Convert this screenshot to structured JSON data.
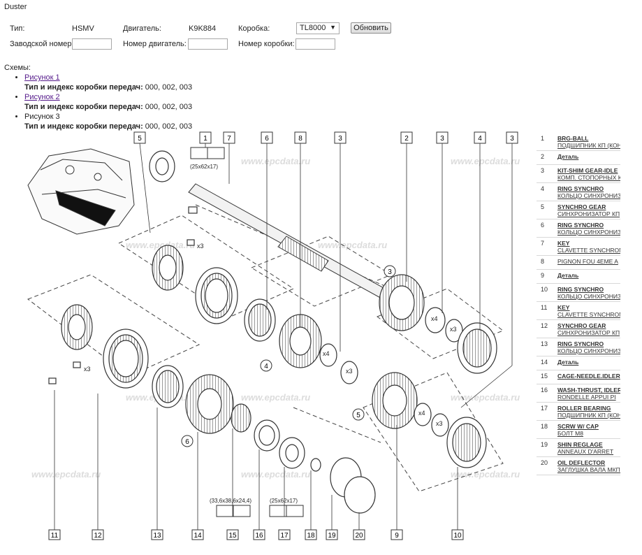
{
  "title": "Duster",
  "filters": {
    "type_label": "Тип:",
    "type_value": "HSMV",
    "engine_label": "Двигатель:",
    "engine_value": "K9K884",
    "gearbox_label": "Коробка:",
    "gearbox_selected": "TL8000",
    "refresh_label": "Обновить",
    "factory_no_label": "Заводской номер:",
    "engine_no_label": "Номер двигатель:",
    "gearbox_no_label": "Номер коробки:"
  },
  "schemes": {
    "title": "Схемы:",
    "items": [
      {
        "label": "Рисунок 1",
        "sub_label": "Тип и индекс коробки передач:",
        "sub_value": " 000, 002, 003",
        "link": true
      },
      {
        "label": "Рисунок 2",
        "sub_label": "Тип и индекс коробки передач:",
        "sub_value": " 000, 002, 003",
        "link": true
      },
      {
        "label": "Рисунок 3",
        "sub_label": "Тип и индекс коробки передач:",
        "sub_value": " 000, 002, 003",
        "link": false
      }
    ]
  },
  "diagram": {
    "watermark": "www.epcdata.ru",
    "top_callouts": [
      "5",
      "1",
      "7",
      "6",
      "8",
      "3",
      "2",
      "3",
      "4",
      "3"
    ],
    "bottom_callouts": [
      "11",
      "12",
      "13",
      "14",
      "15",
      "16",
      "17",
      "18",
      "19",
      "20"
    ],
    "circle_callouts": [
      "3",
      "4",
      "5",
      "6"
    ],
    "dim_1": "(25x62x17)",
    "dim_15": "(33,6x38,6x24,4)",
    "dim_17": "(25x62x17)",
    "qty_x3": "x3",
    "qty_x4": "x4"
  },
  "parts": [
    {
      "num": "1",
      "name": "BRG-BALL",
      "desc": "ПОДШИПНИК КП (КОНИ"
    },
    {
      "num": "2",
      "name": "Деталь",
      "desc": ""
    },
    {
      "num": "3",
      "name": "KIT-SHIM GEAR-IDLE",
      "desc": "КОМП. СТОПОРНЫХ КО"
    },
    {
      "num": "4",
      "name": "RING SYNCHRO",
      "desc": "КОЛЬЦО СИНХРОНИЗАТ"
    },
    {
      "num": "5",
      "name": "SYNCHRO GEAR",
      "desc": "СИНХРОНИЗАТОР КП"
    },
    {
      "num": "6",
      "name": "RING SYNCHRO",
      "desc": "КОЛЬЦО СИНХРОНИЗАТ"
    },
    {
      "num": "7",
      "name": "KEY",
      "desc": "CLAVETTE SYNCHRON"
    },
    {
      "num": "8",
      "name": "",
      "desc": "PIGNON FOU 4EME A"
    },
    {
      "num": "9",
      "name": "Деталь",
      "desc": ""
    },
    {
      "num": "10",
      "name": "RING SYNCHRO",
      "desc": "КОЛЬЦО СИНХРОНИЗАТ"
    },
    {
      "num": "11",
      "name": "KEY",
      "desc": "CLAVETTE SYNCHRON"
    },
    {
      "num": "12",
      "name": "SYNCHRO GEAR",
      "desc": "СИНХРОНИЗАТОР КП"
    },
    {
      "num": "13",
      "name": "RING SYNCHRO",
      "desc": "КОЛЬЦО СИНХРОНИЗАТ"
    },
    {
      "num": "14",
      "name": "Деталь",
      "desc": ""
    },
    {
      "num": "15",
      "name": "CAGE-NEEDLE.IDLER",
      "desc": ""
    },
    {
      "num": "16",
      "name": "WASH-THRUST, IDLER",
      "desc": "RONDELLE APPUI PI"
    },
    {
      "num": "17",
      "name": "ROLLER BEARING",
      "desc": "ПОДШИПНИК КП (КОНИ"
    },
    {
      "num": "18",
      "name": "SCRW W/ CAP",
      "desc": "БОЛТ M8"
    },
    {
      "num": "19",
      "name": "SHIN REGLAGE",
      "desc": "ANNEAUX D'ARRET"
    },
    {
      "num": "20",
      "name": "OIL DEFLECTOR",
      "desc": "ЗАГЛУШКА ВАЛА МКПП"
    }
  ]
}
